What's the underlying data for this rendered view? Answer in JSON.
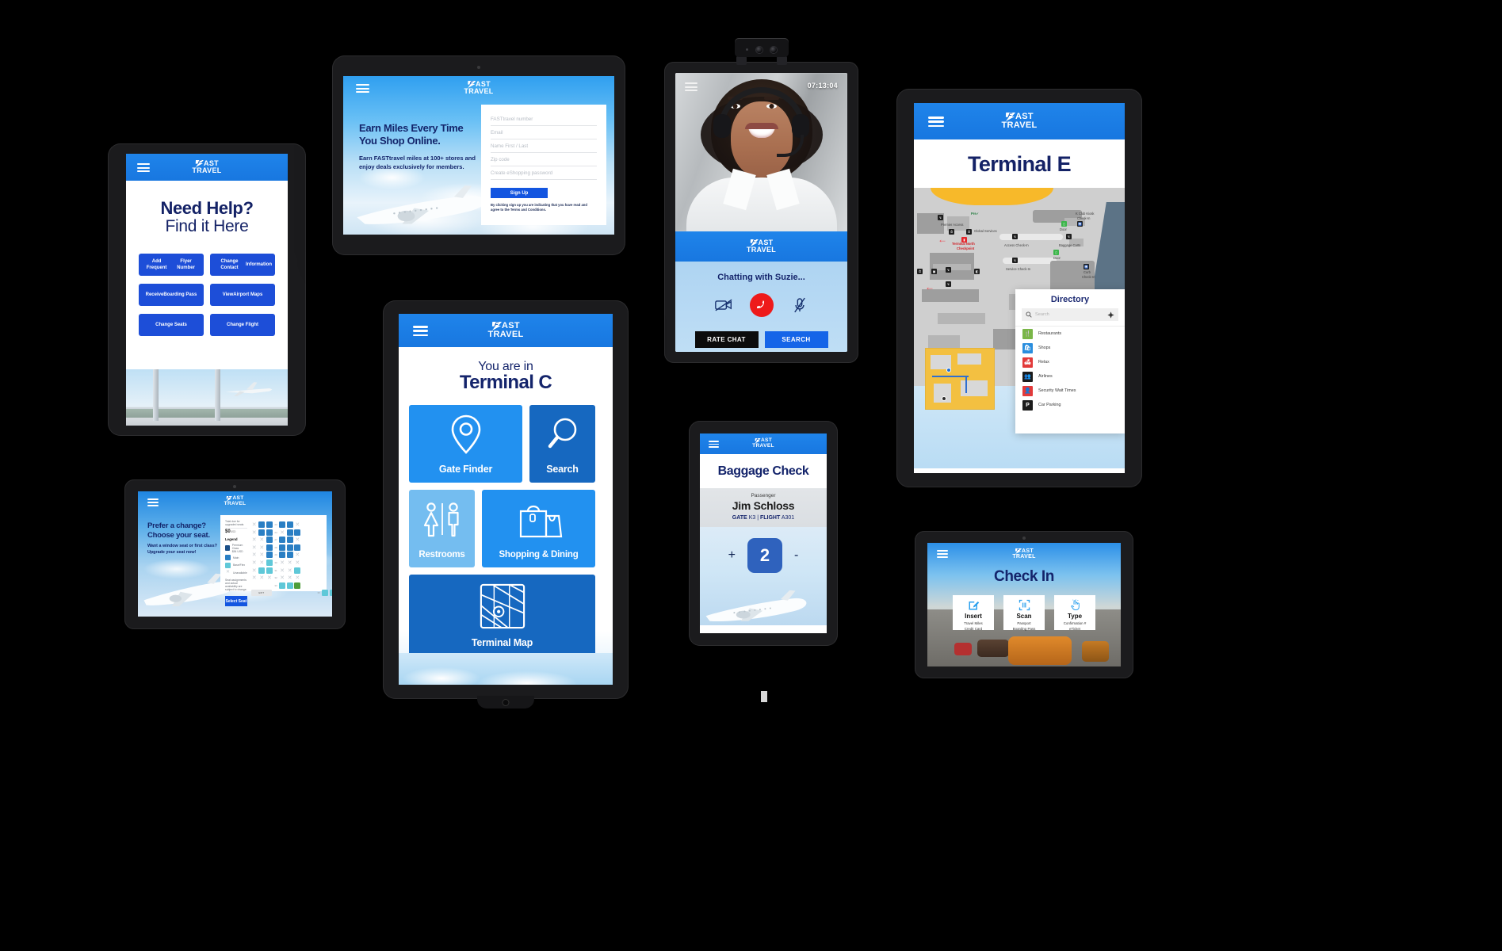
{
  "brand": {
    "mark": "F",
    "name_top": "AST",
    "name_bottom": "TRAVEL"
  },
  "devices": {
    "need_help": {
      "device_name": "tablet-need-help",
      "title_line1": "Need Help?",
      "title_line2": "Find it Here",
      "buttons": [
        "Add Frequent\nFlyer Number",
        "Change Contact\nInformation",
        "Receive\nBoarding Pass",
        "View\nAirport Maps",
        "Change Seats",
        "Change Flight"
      ],
      "buttons_flat": [
        "Add Frequent Flyer Number",
        "Change Contact Information",
        "Receive Boarding Pass",
        "View Airport Maps",
        "Change Seats",
        "Change Flight"
      ]
    },
    "earn_miles": {
      "device_name": "tablet-earn-miles",
      "headline": "Earn Miles Every Time You Shop Online.",
      "headline_l1": "Earn Miles Every Time",
      "headline_l2": "You Shop Online.",
      "body": "Earn FASTtravel miles at 100+ stores and enjoy deals exclusively for members.",
      "fields": [
        {
          "placeholder": "FASTtravel number"
        },
        {
          "placeholder": "Email"
        },
        {
          "placeholder": "Name First / Last"
        },
        {
          "placeholder": "Zip code"
        },
        {
          "placeholder": "Create eShopping password"
        }
      ],
      "signup_label": "Sign Up",
      "terms": "By clicking sign up you are indicating that you have read and agree to the Terms and Conditions."
    },
    "video_kiosk": {
      "device_name": "kiosk-video-chat",
      "clock": "07:13:04",
      "status": "Chatting  with Suzie...",
      "controls": [
        "video-off-icon",
        "end-call-icon",
        "mic-off-icon"
      ],
      "buttons": [
        {
          "label": "RATE CHAT",
          "style": "dark"
        },
        {
          "label": "SEARCH",
          "style": "blue"
        }
      ]
    },
    "terminal_e": {
      "device_name": "tablet-terminal-e",
      "title": "Terminal E",
      "map_labels": [
        "Pre✓",
        "Premier Access",
        "Global Services",
        "Terminal  North",
        "Checkpoint",
        "Access Check-In",
        "Service Check-In",
        "Door",
        "Door",
        "Baggage Carts",
        "K Club Kiosk",
        "Check-In",
        "Curb",
        "Check-In"
      ],
      "directory": {
        "title": "Directory",
        "search_placeholder": "Search",
        "items": [
          {
            "label": "Restaurants",
            "color": "#7ab648",
            "glyph": "🍴"
          },
          {
            "label": "Shops",
            "color": "#2a8ede",
            "glyph": "🛍"
          },
          {
            "label": "Relax",
            "color": "#e23a3a",
            "glyph": "🛋"
          },
          {
            "label": "Airlines",
            "color": "#1c1c1c",
            "glyph": "👥"
          },
          {
            "label": "Security Wait Times",
            "color": "#e23a3a",
            "glyph": "👤"
          },
          {
            "label": "Car Parking",
            "color": "#1c1c1c",
            "glyph": "P"
          }
        ]
      }
    },
    "terminal_c": {
      "device_name": "tablet-terminal-c",
      "subtitle": "You are in",
      "title": "Terminal C",
      "tiles": [
        {
          "label": "Gate Finder",
          "icon": "map-pin-icon"
        },
        {
          "label": "Search",
          "icon": "magnifier-icon"
        },
        {
          "label": "Restrooms",
          "icon": "restrooms-icon"
        },
        {
          "label": "Shopping & Dining",
          "icon": "shopping-bags-icon"
        },
        {
          "label": "Terminal Map",
          "icon": "map-grid-icon"
        }
      ]
    },
    "baggage": {
      "device_name": "phone-baggage-check",
      "title": "Baggage Check",
      "passenger_label": "Passenger",
      "passenger_name": "Jim Schloss",
      "gate_label": "GATE",
      "gate_value": "K3",
      "separator": "|",
      "flight_label": "FLIGHT",
      "flight_value": "A301",
      "plus": "+",
      "minus": "-",
      "count": "2"
    },
    "check_in": {
      "device_name": "tablet-check-in",
      "title": "Check In",
      "options": [
        {
          "name": "Insert",
          "icon": "insert-card-icon",
          "sub1": "Travel Miles",
          "sub2": "Credit Card"
        },
        {
          "name": "Scan",
          "icon": "scan-code-icon",
          "sub1": "Passport",
          "sub2": "Boarding Pass"
        },
        {
          "name": "Type",
          "icon": "type-hand-icon",
          "sub1": "Confirmation #",
          "sub2": "eTicket"
        }
      ]
    },
    "choose_seat": {
      "device_name": "tablet-choose-seat",
      "headline_l1": "Prefer a change?",
      "headline_l2": "Choose your seat.",
      "body_l1": "Want a window seat or first class?",
      "body_l2": "Upgrade your seat  now!",
      "total_label": "Total due for upgraded seats",
      "total_price": "$0",
      "total_currency": "USD",
      "legend_title": "Legend",
      "legend": [
        {
          "label": "Premium Class",
          "sub": "$84 USD",
          "color": "#1b4f88"
        },
        {
          "label": "Main",
          "sub": "",
          "color": "#2a7fc4"
        },
        {
          "label": "Base/Flex",
          "sub": "",
          "color": "#5fc8d8"
        },
        {
          "label": "Unavailable",
          "sub": "",
          "color": "#d5dade"
        }
      ],
      "disclaimer": "Seat assignments and actual availability are subject to change.",
      "select_label": "Select Seat",
      "exit_label": "EXIT",
      "row_numbers": [
        "23",
        "24",
        "27",
        "28",
        "29",
        "30",
        "31",
        "32",
        "33",
        "35"
      ]
    }
  },
  "colors": {
    "brand_blue": "#1f84ea",
    "deep_navy": "#14246b",
    "tile_light": "#2291f0",
    "tile_dark": "#1668c0",
    "tile_pale": "#74bdf0",
    "cta_blue": "#1355e0",
    "end_call_red": "#ee1a1a",
    "background": "#000000"
  }
}
